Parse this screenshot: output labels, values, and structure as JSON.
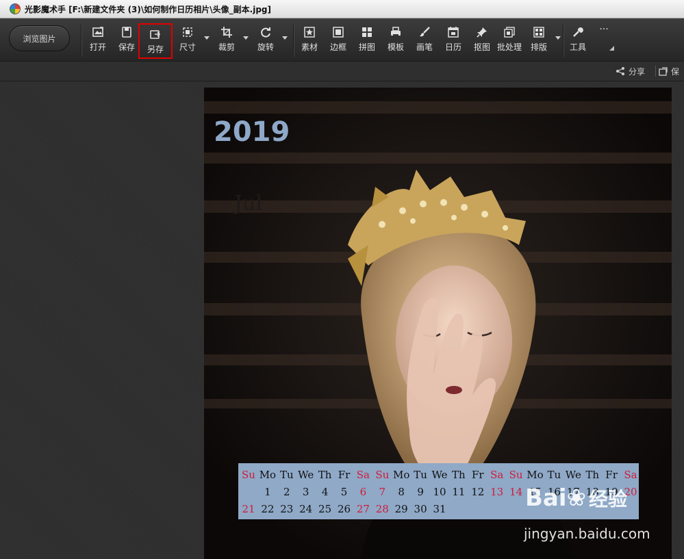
{
  "window": {
    "title": "光影魔术手  [F:\\新建文件夹 (3)\\如何制作日历相片\\头像_副本.jpg]"
  },
  "toolbar": {
    "browse_label": "浏览图片",
    "tools": [
      {
        "id": "open",
        "label": "打开",
        "icon": "open-icon"
      },
      {
        "id": "save",
        "label": "保存",
        "icon": "save-icon"
      },
      {
        "id": "save-as",
        "label": "另存",
        "icon": "save-as-icon",
        "highlighted": true
      },
      {
        "id": "size",
        "label": "尺寸",
        "icon": "size-icon",
        "dropdown": true
      },
      {
        "id": "crop",
        "label": "裁剪",
        "icon": "crop-icon",
        "dropdown": true
      },
      {
        "id": "rotate",
        "label": "旋转",
        "icon": "rotate-icon",
        "dropdown": true
      },
      {
        "id": "material",
        "label": "素材",
        "icon": "star-icon"
      },
      {
        "id": "border",
        "label": "边框",
        "icon": "border-icon"
      },
      {
        "id": "collage",
        "label": "拼图",
        "icon": "collage-icon"
      },
      {
        "id": "template",
        "label": "模板",
        "icon": "template-icon"
      },
      {
        "id": "brush",
        "label": "画笔",
        "icon": "brush-icon"
      },
      {
        "id": "calendar",
        "label": "日历",
        "icon": "calendar-icon"
      },
      {
        "id": "cutout",
        "label": "抠图",
        "icon": "pin-icon"
      },
      {
        "id": "batch",
        "label": "批处理",
        "icon": "batch-icon"
      },
      {
        "id": "layout",
        "label": "排版",
        "icon": "layout-icon",
        "dropdown": true
      },
      {
        "id": "tools",
        "label": "工具",
        "icon": "wrench-icon"
      }
    ],
    "more_label": "···"
  },
  "subbar": {
    "share_label": "分享",
    "save_label": "保"
  },
  "photo": {
    "year": "2019",
    "month": "Jul",
    "calendar": {
      "row1": [
        "Su",
        "Mo",
        "Tu",
        "We",
        "Th",
        "Fr",
        "Sa",
        "Su",
        "Mo",
        "Tu",
        "We",
        "Th",
        "Fr",
        "Sa",
        "Su",
        "Mo",
        "Tu",
        "We",
        "Th",
        "Fr",
        "Sa"
      ],
      "row2": [
        "",
        "1",
        "2",
        "3",
        "4",
        "5",
        "6",
        "7",
        "8",
        "9",
        "10",
        "11",
        "12",
        "13",
        "14",
        "15",
        "16",
        "17",
        "18",
        "19",
        "20"
      ],
      "row3": [
        "21",
        "22",
        "23",
        "24",
        "25",
        "26",
        "27",
        "28",
        "29",
        "30",
        "31"
      ],
      "red_columns": [
        0,
        6,
        7,
        13,
        14,
        20
      ],
      "weekend_color": "#d11a3a",
      "strip_color": "#8fa9c7"
    }
  },
  "watermark": {
    "logo_prefix": "Bai",
    "logo_suffix": "经验",
    "url": "jingyan.baidu.com"
  }
}
